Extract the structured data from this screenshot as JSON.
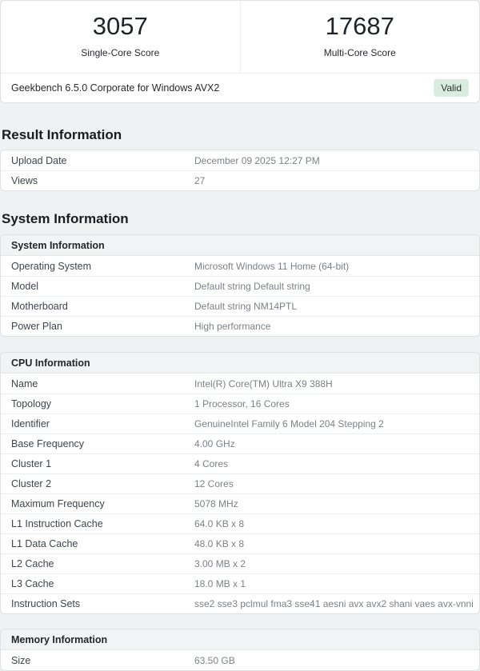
{
  "scores": [
    {
      "value": "3057",
      "label": "Single-Core Score"
    },
    {
      "value": "17687",
      "label": "Multi-Core Score"
    }
  ],
  "banner": {
    "text": "Geekbench 6.5.0 Corporate for Windows AVX2",
    "badge": "Valid"
  },
  "sections": {
    "result": {
      "title": "Result Information",
      "rows": [
        {
          "label": "Upload Date",
          "value": "December 09 2025 12:27 PM"
        },
        {
          "label": "Views",
          "value": "27"
        }
      ]
    },
    "system": {
      "title": "System Information",
      "tables": [
        {
          "header": "System Information",
          "rows": [
            {
              "label": "Operating System",
              "value": "Microsoft Windows 11 Home (64-bit)"
            },
            {
              "label": "Model",
              "value": "Default string Default string"
            },
            {
              "label": "Motherboard",
              "value": "Default string NM14PTL"
            },
            {
              "label": "Power Plan",
              "value": "High performance"
            }
          ]
        },
        {
          "header": "CPU Information",
          "rows": [
            {
              "label": "Name",
              "value": "Intel(R) Core(TM) Ultra X9 388H"
            },
            {
              "label": "Topology",
              "value": "1 Processor, 16 Cores"
            },
            {
              "label": "Identifier",
              "value": "GenuineIntel Family 6 Model 204 Stepping 2"
            },
            {
              "label": "Base Frequency",
              "value": "4.00 GHz"
            },
            {
              "label": "Cluster 1",
              "value": "4 Cores"
            },
            {
              "label": "Cluster 2",
              "value": "12 Cores"
            },
            {
              "label": "Maximum Frequency",
              "value": "5078 MHz"
            },
            {
              "label": "L1 Instruction Cache",
              "value": "64.0 KB x 8"
            },
            {
              "label": "L1 Data Cache",
              "value": "48.0 KB x 8"
            },
            {
              "label": "L2 Cache",
              "value": "3.00 MB x 2"
            },
            {
              "label": "L3 Cache",
              "value": "18.0 MB x 1"
            },
            {
              "label": "Instruction Sets",
              "value": "sse2 sse3 pclmul fma3 sse41 aesni avx avx2 shani vaes avx-vnni"
            }
          ]
        },
        {
          "header": "Memory Information",
          "rows": [
            {
              "label": "Size",
              "value": "63.50 GB"
            }
          ]
        }
      ]
    }
  },
  "colors": {
    "badge_bg": "#d9ecdf",
    "badge_text": "#27352c",
    "page_bg": "#f0f1f2"
  }
}
